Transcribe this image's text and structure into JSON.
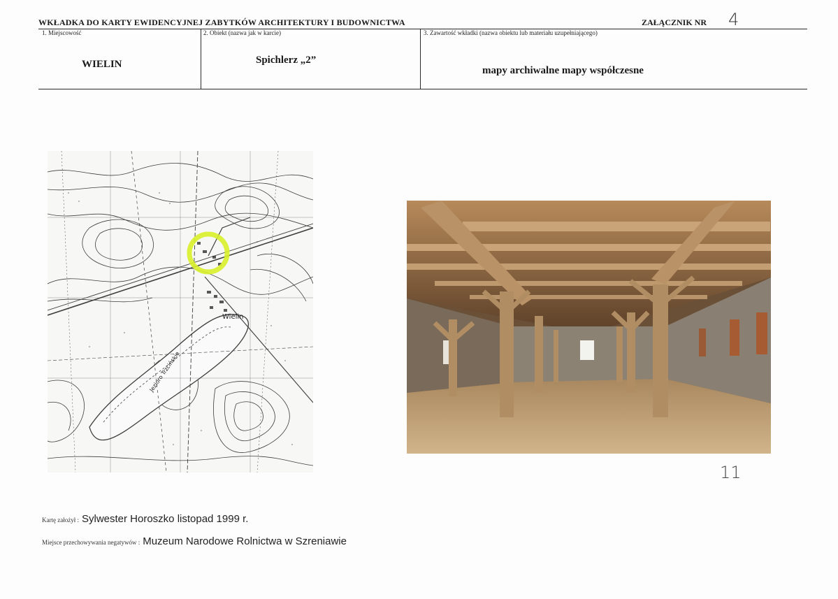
{
  "header": {
    "title": "WKŁADKA DO KARTY EWIDENCYJNEJ ZABYTKÓW ARCHITEKTURY I BUDOWNICTWA",
    "attachment_label": "ZAŁĄCZNIK NR",
    "attachment_number": "4"
  },
  "fields": [
    {
      "label": "1. Miejscowość",
      "value": "WIELIN"
    },
    {
      "label": "2. Obiekt (nazwa jak w karcie)",
      "value": "Spichlerz „2”"
    },
    {
      "label": "3. Zawartość wkładki (nazwa obiektu lub materiału uzupełniającego)",
      "value": "mapy archiwalne mapy współczesne"
    }
  ],
  "map": {
    "place_label": "Wielin",
    "lake_label": "Jezioro Trzcińskie",
    "highlight_color": "#d8ef2a"
  },
  "photo": {
    "handwritten_number": "11"
  },
  "footer": {
    "author_label": "Kartę założył :",
    "author_value": "Sylwester  Horoszko listopad  1999 r.",
    "storage_label": "Miejsce przechowywania negatywów :",
    "storage_value": "Muzeum Narodowe Rolnictwa w Szreniawie"
  }
}
